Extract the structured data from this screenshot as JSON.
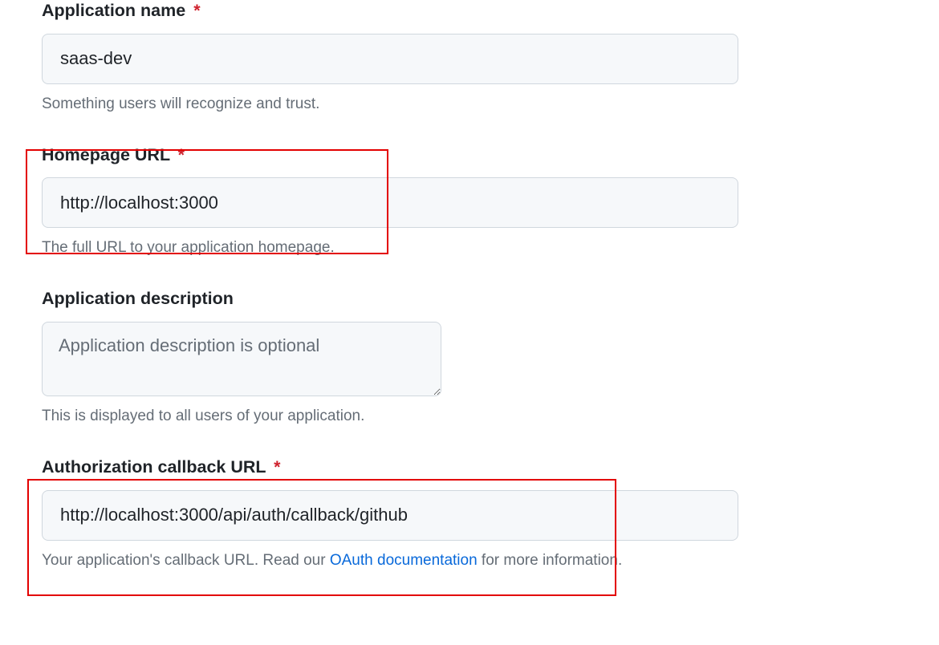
{
  "fields": {
    "app_name": {
      "label": "Application name",
      "required_marker": "*",
      "value": "saas-dev",
      "help": "Something users will recognize and trust."
    },
    "homepage_url": {
      "label": "Homepage URL",
      "required_marker": "*",
      "value": "http://localhost:3000",
      "help": "The full URL to your application homepage."
    },
    "description": {
      "label": "Application description",
      "placeholder": "Application description is optional",
      "value": "",
      "help": "This is displayed to all users of your application."
    },
    "callback_url": {
      "label": "Authorization callback URL",
      "required_marker": "*",
      "value": "http://localhost:3000/api/auth/callback/github",
      "help_prefix": "Your application's callback URL. Read our ",
      "help_link_text": "OAuth documentation",
      "help_suffix": " for more information."
    }
  },
  "colors": {
    "required": "#cf222e",
    "link": "#0969da",
    "annotation": "#e30000",
    "input_bg": "#f6f8fa",
    "border": "#d0d7de",
    "help_text": "#656d76"
  }
}
